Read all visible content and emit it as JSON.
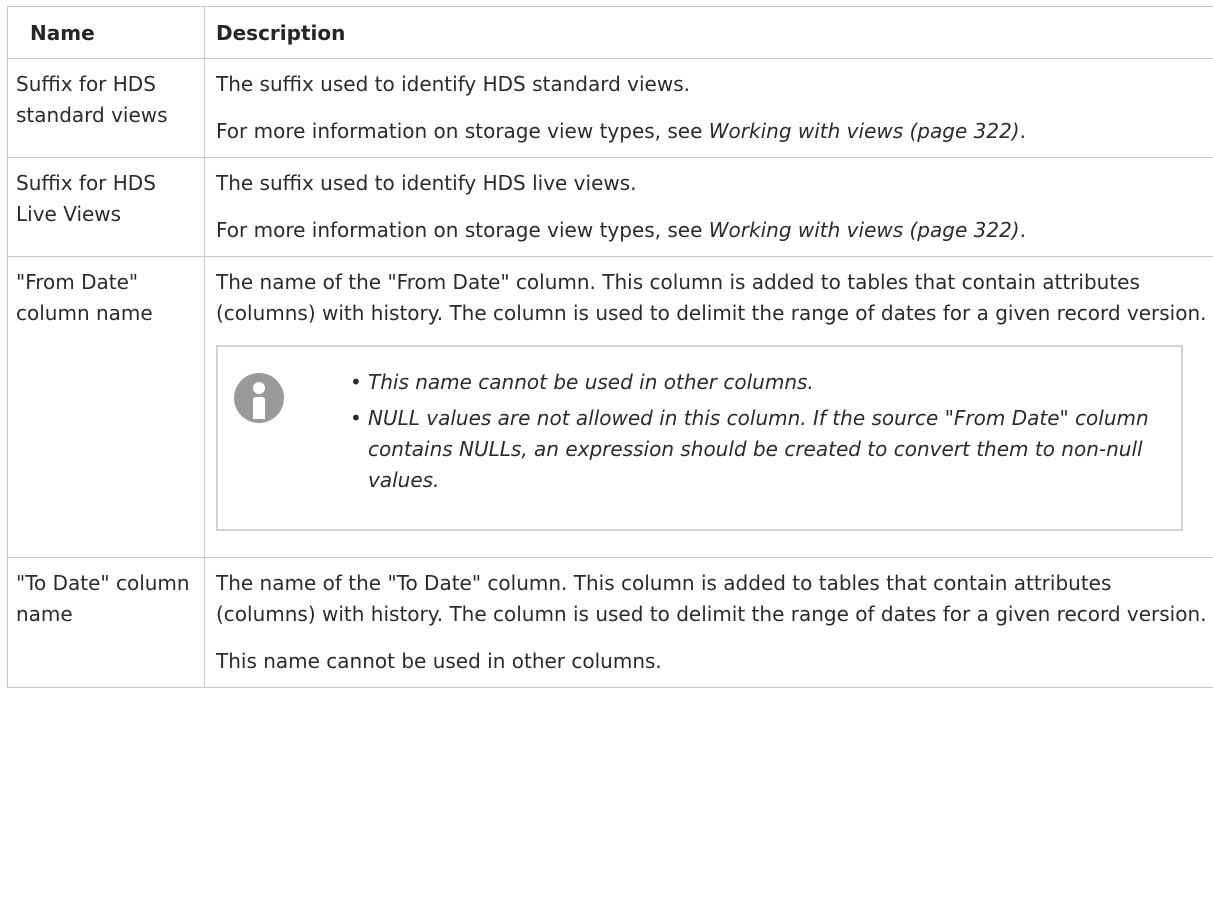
{
  "headers": {
    "name": "Name",
    "description": "Description"
  },
  "rows": [
    {
      "name": "Suffix for HDS standard views",
      "desc_p1": "The suffix used to identify HDS standard views.",
      "desc_p2_prefix": "For more information on storage view types, see ",
      "desc_p2_link": "Working with views (page 322)",
      "desc_p2_suffix": "."
    },
    {
      "name": "Suffix for HDS Live Views",
      "desc_p1": "The suffix used to identify HDS live views.",
      "desc_p2_prefix": "For more information on storage view types, see ",
      "desc_p2_link": "Working with views (page 322)",
      "desc_p2_suffix": "."
    },
    {
      "name": "\"From Date\" column name",
      "desc_p1": "The name of the \"From Date\" column. This column is added to tables that contain attributes (columns) with history. The column is used to delimit the range of dates for a given record version.",
      "note_icon": "info-icon",
      "note_items": [
        "This name cannot be used in other columns.",
        "NULL values are not allowed in this column. If the source \"From Date\" column contains NULLs, an expression should be created to convert them to non-null values."
      ]
    },
    {
      "name": "\"To Date\" column name",
      "desc_p1": "The name of the \"To Date\" column. This column is added to tables that contain attributes (columns) with history. The column is used to delimit the range of dates for a given record version.",
      "desc_p2": "This name cannot be used in other columns."
    }
  ]
}
